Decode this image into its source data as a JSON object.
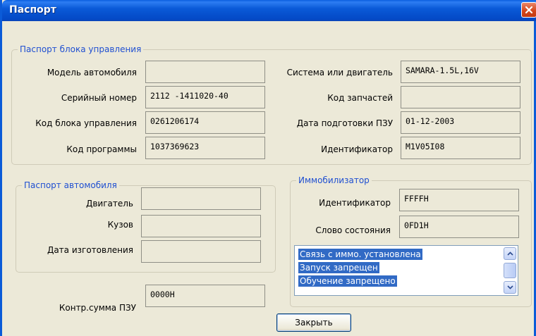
{
  "window": {
    "title": "Паспорт"
  },
  "ecu_passport": {
    "title": "Паспорт блока управления",
    "fields": [
      {
        "label": "Модель автомобиля",
        "value": ""
      },
      {
        "label": "Серийный номер",
        "value": "2112 -1411020-40"
      },
      {
        "label": "Код блока управления",
        "value": "0261206174"
      },
      {
        "label": "Код программы",
        "value": "1037369623"
      },
      {
        "label": "Система или двигатель",
        "value": "SAMARA-1.5L,16V"
      },
      {
        "label": "Код запчастей",
        "value": ""
      },
      {
        "label": "Дата подготовки ПЗУ",
        "value": "01-12-2003"
      },
      {
        "label": "Идентификатор",
        "value": "M1V05I08"
      }
    ]
  },
  "vehicle_passport": {
    "title": "Паспорт автомобиля",
    "fields": [
      {
        "label": "Двигатель",
        "value": ""
      },
      {
        "label": "Кузов",
        "value": ""
      },
      {
        "label": "Дата изготовления",
        "value": ""
      }
    ]
  },
  "checksum": {
    "label": "Контр.сумма ПЗУ",
    "value": "0000H"
  },
  "immobilizer": {
    "title": "Иммобилизатор",
    "fields": [
      {
        "label": "Идентификатор",
        "value": "FFFFH"
      },
      {
        "label": "Слово состояния",
        "value": "0FD1H"
      }
    ],
    "status_list": [
      "Связь с иммо. установлена",
      "Запуск запрещен",
      "Обучение запрещено"
    ]
  },
  "buttons": {
    "close": "Закрыть"
  },
  "colors": {
    "titlebar": "#0a5ad8",
    "group_title": "#1f4fd1",
    "selection": "#316ac5",
    "close_red": "#d5471c"
  },
  "icons": [
    "close-icon",
    "scroll-up-icon",
    "scroll-down-icon"
  ]
}
